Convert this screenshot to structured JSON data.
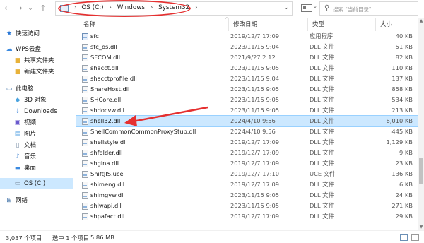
{
  "nav": {
    "back": "←",
    "forward": "→",
    "recent": "⌄",
    "up": "↑",
    "refresh": "↻",
    "dropdown": "⌄"
  },
  "address": {
    "crumbs": [
      "OS (C:)",
      "Windows",
      "System32"
    ],
    "separator": "›"
  },
  "search": {
    "placeholder": "搜索 \"当前目录\""
  },
  "sidebar": {
    "items": [
      {
        "label": "快速访问",
        "icon": "star-icon",
        "color": "#2b78d6"
      },
      {
        "label": "WPS云盘",
        "icon": "cloud-icon",
        "color": "#3b8ae0"
      },
      {
        "label": "共享文件夹",
        "icon": "folder-icon",
        "color": "#e8b23a"
      },
      {
        "label": "新建文件夹",
        "icon": "folder-icon",
        "color": "#e8b23a"
      },
      {
        "label": "此电脑",
        "icon": "computer-icon",
        "color": "#3b6ea5"
      },
      {
        "label": "3D 对象",
        "icon": "cube-icon",
        "color": "#4aa3df"
      },
      {
        "label": "Downloads",
        "icon": "download-icon",
        "color": "#2b78d6"
      },
      {
        "label": "视频",
        "icon": "video-icon",
        "color": "#6a5acd"
      },
      {
        "label": "图片",
        "icon": "picture-icon",
        "color": "#4a9be0"
      },
      {
        "label": "文档",
        "icon": "document-icon",
        "color": "#7a8ea6"
      },
      {
        "label": "音乐",
        "icon": "music-icon",
        "color": "#3b7fd0"
      },
      {
        "label": "桌面",
        "icon": "desktop-icon",
        "color": "#3b8ae0"
      },
      {
        "label": "OS (C:)",
        "icon": "drive-icon",
        "color": "#6f7f90"
      },
      {
        "label": "网络",
        "icon": "network-icon",
        "color": "#3b6ea5"
      }
    ],
    "selected": "OS (C:)"
  },
  "columns": {
    "name": "名称",
    "date": "修改日期",
    "type": "类型",
    "size": "大小",
    "sort_indicator": "^"
  },
  "files": [
    {
      "name": "sfc",
      "date": "2019/12/7 17:09",
      "type": "应用程序",
      "size": "40 KB",
      "kind": "exe"
    },
    {
      "name": "sfc_os.dll",
      "date": "2023/11/15 9:04",
      "type": "DLL 文件",
      "size": "51 KB",
      "kind": "dll"
    },
    {
      "name": "SFCOM.dll",
      "date": "2021/9/27 2:12",
      "type": "DLL 文件",
      "size": "82 KB",
      "kind": "dll"
    },
    {
      "name": "shacct.dll",
      "date": "2023/11/15 9:05",
      "type": "DLL 文件",
      "size": "110 KB",
      "kind": "dll"
    },
    {
      "name": "shacctprofile.dll",
      "date": "2023/11/15 9:04",
      "type": "DLL 文件",
      "size": "137 KB",
      "kind": "dll"
    },
    {
      "name": "ShareHost.dll",
      "date": "2023/11/15 9:05",
      "type": "DLL 文件",
      "size": "858 KB",
      "kind": "dll"
    },
    {
      "name": "SHCore.dll",
      "date": "2023/11/15 9:05",
      "type": "DLL 文件",
      "size": "534 KB",
      "kind": "dll"
    },
    {
      "name": "shdocvw.dll",
      "date": "2023/11/15 9:05",
      "type": "DLL 文件",
      "size": "213 KB",
      "kind": "dll"
    },
    {
      "name": "shell32.dll",
      "date": "2024/4/10 9:56",
      "type": "DLL 文件",
      "size": "6,010 KB",
      "kind": "dll"
    },
    {
      "name": "ShellCommonCommonProxyStub.dll",
      "date": "2024/4/10 9:56",
      "type": "DLL 文件",
      "size": "445 KB",
      "kind": "dll"
    },
    {
      "name": "shellstyle.dll",
      "date": "2019/12/7 17:09",
      "type": "DLL 文件",
      "size": "1,129 KB",
      "kind": "dll"
    },
    {
      "name": "shfolder.dll",
      "date": "2019/12/7 17:09",
      "type": "DLL 文件",
      "size": "9 KB",
      "kind": "dll"
    },
    {
      "name": "shgina.dll",
      "date": "2019/12/7 17:09",
      "type": "DLL 文件",
      "size": "23 KB",
      "kind": "dll"
    },
    {
      "name": "ShiftJIS.uce",
      "date": "2019/12/7 17:10",
      "type": "UCE 文件",
      "size": "136 KB",
      "kind": "dll"
    },
    {
      "name": "shimeng.dll",
      "date": "2019/12/7 17:09",
      "type": "DLL 文件",
      "size": "6 KB",
      "kind": "dll"
    },
    {
      "name": "shimgvw.dll",
      "date": "2023/11/15 9:05",
      "type": "DLL 文件",
      "size": "24 KB",
      "kind": "dll"
    },
    {
      "name": "shlwapi.dll",
      "date": "2023/11/15 9:05",
      "type": "DLL 文件",
      "size": "271 KB",
      "kind": "dll"
    },
    {
      "name": "shpafact.dll",
      "date": "2019/12/7 17:09",
      "type": "DLL 文件",
      "size": "29 KB",
      "kind": "dll"
    }
  ],
  "highlighted_file": "shell32.dll",
  "status": {
    "item_count": "3,037 个项目",
    "selection": "选中 1 个项目",
    "size": "5.86 MB"
  },
  "colors": {
    "annotation_red": "#e53030",
    "selection_blue": "#cce8ff"
  }
}
